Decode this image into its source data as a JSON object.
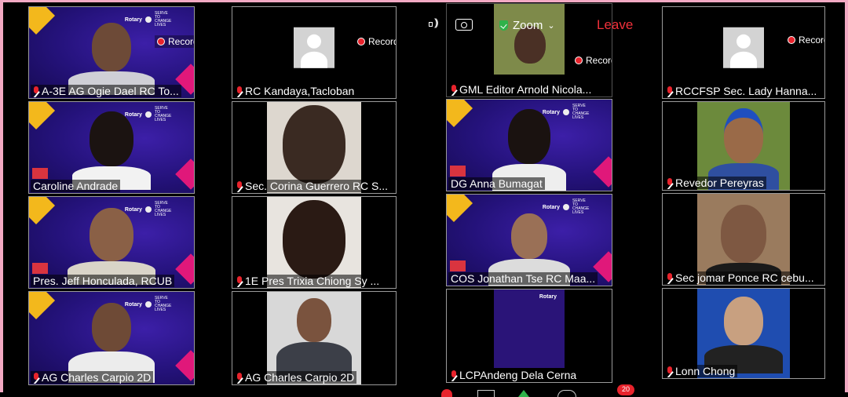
{
  "meeting": {
    "app_label": "Zoom",
    "leave_label": "Leave",
    "recording_label": "Recording",
    "notification_count": "20"
  },
  "participants": [
    {
      "name": "A-3E AG Ogie Dael  RC To..."
    },
    {
      "name": "RC Kandaya,Tacloban"
    },
    {
      "name": "GML Editor Arnold Nicola..."
    },
    {
      "name": "RCCFSP Sec. Lady Hanna..."
    },
    {
      "name": "Caroline Andrade"
    },
    {
      "name": "Sec. Corina Guerrero RC S..."
    },
    {
      "name": "DG Anna Bumagat"
    },
    {
      "name": "Revedor Pereyras"
    },
    {
      "name": "Pres. Jeff Honculada, RCUB"
    },
    {
      "name": "1E Pres Trixia Chiong Sy ..."
    },
    {
      "name": "COS Jonathan Tse RC Maa..."
    },
    {
      "name": "Sec jomar Ponce RC cebu..."
    },
    {
      "name": "AG Charles  Carpio 2D"
    },
    {
      "name": "AG Charles  Carpio 2D"
    },
    {
      "name": "LCPAndeng Dela Cerna"
    },
    {
      "name": "Lonn Chong"
    }
  ],
  "rotary_banner": {
    "brand": "Rotary",
    "tagline": "SERVE TO CHANGE LIVES"
  },
  "icons": {
    "mute": "mic-muted-icon",
    "recording": "recording-dot-icon",
    "speaker": "speaker-icon",
    "camera_switch": "camera-switch-icon",
    "security": "shield-icon",
    "avatar": "avatar-placeholder-icon"
  },
  "colors": {
    "accent_red": "#e8232c",
    "frame_pink": "#f2a9c3",
    "banner_purple": "#24127a",
    "security_green": "#2fb24a"
  }
}
